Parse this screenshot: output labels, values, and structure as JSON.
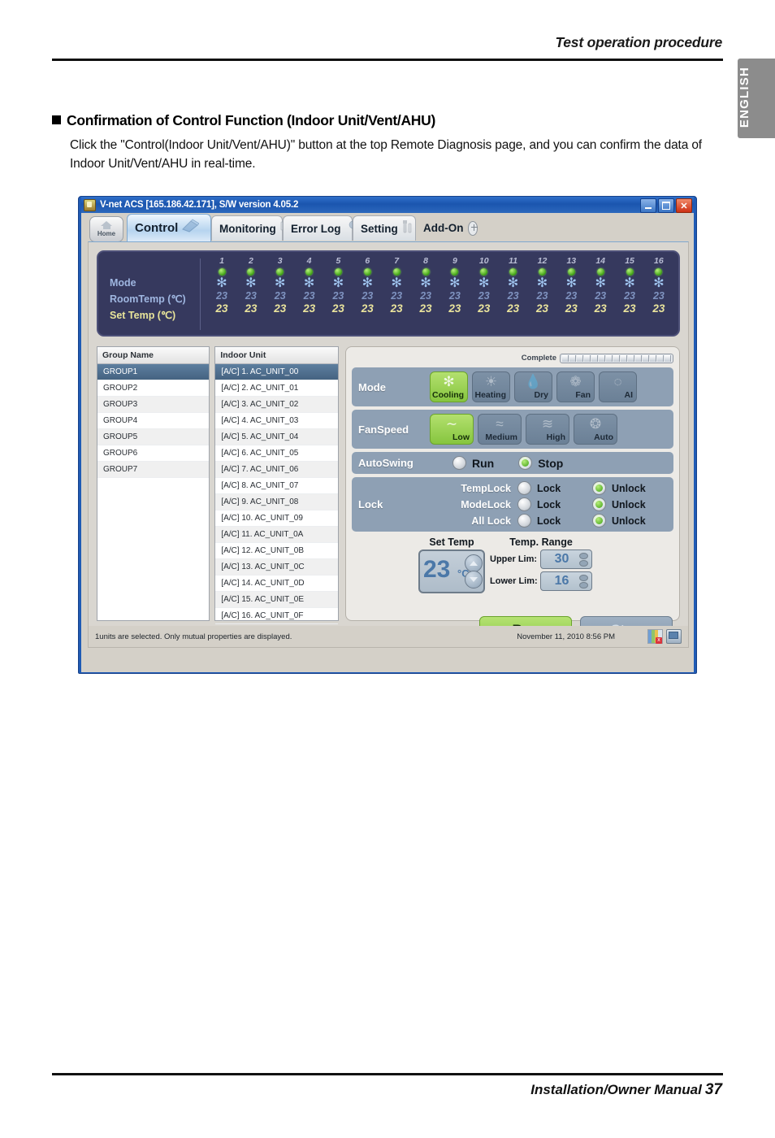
{
  "page": {
    "header_title": "Test operation procedure",
    "side_tab": "ENGLISH",
    "section_heading": "Confirmation of Control Function (Indoor Unit/Vent/AHU)",
    "section_body": "Click the \"Control(Indoor Unit/Vent/AHU)\" button at the top Remote Diagnosis page, and  you can confirm the data of Indoor Unit/Vent/AHU in real-time.",
    "footer_text": "Installation/Owner Manual",
    "page_number": "37"
  },
  "window": {
    "title": "V-net ACS [165.186.42.171],   S/W version 4.05.2",
    "app_icon": "app-icon",
    "minimize": "_",
    "maximize": "□",
    "close": "✕"
  },
  "toolbar": {
    "home_label": "Home",
    "tabs": [
      {
        "label": "Control",
        "icon": "control-icon",
        "active": true
      },
      {
        "label": "Monitoring",
        "icon": "monitor-icon",
        "active": false
      },
      {
        "label": "Error Log",
        "icon": "wrench-icon",
        "active": false
      },
      {
        "label": "Setting",
        "icon": "tools-icon",
        "active": false
      },
      {
        "label": "Add-On",
        "icon": "plus-circle-icon",
        "active": false
      }
    ]
  },
  "status_panel": {
    "row_labels": {
      "mode": "Mode",
      "room_temp": "RoomTemp (℃)",
      "set_temp": "Set Temp  (℃)"
    },
    "columns": [
      {
        "index": "1",
        "power": "on",
        "mode_icon": "snowflake-icon",
        "room_temp": "23",
        "set_temp": "23"
      },
      {
        "index": "2",
        "power": "on",
        "mode_icon": "snowflake-icon",
        "room_temp": "23",
        "set_temp": "23"
      },
      {
        "index": "3",
        "power": "on",
        "mode_icon": "snowflake-icon",
        "room_temp": "23",
        "set_temp": "23"
      },
      {
        "index": "4",
        "power": "on",
        "mode_icon": "snowflake-icon",
        "room_temp": "23",
        "set_temp": "23"
      },
      {
        "index": "5",
        "power": "on",
        "mode_icon": "snowflake-icon",
        "room_temp": "23",
        "set_temp": "23"
      },
      {
        "index": "6",
        "power": "on",
        "mode_icon": "snowflake-icon",
        "room_temp": "23",
        "set_temp": "23"
      },
      {
        "index": "7",
        "power": "on",
        "mode_icon": "snowflake-icon",
        "room_temp": "23",
        "set_temp": "23"
      },
      {
        "index": "8",
        "power": "on",
        "mode_icon": "snowflake-icon",
        "room_temp": "23",
        "set_temp": "23"
      },
      {
        "index": "9",
        "power": "on",
        "mode_icon": "snowflake-icon",
        "room_temp": "23",
        "set_temp": "23"
      },
      {
        "index": "10",
        "power": "on",
        "mode_icon": "snowflake-icon",
        "room_temp": "23",
        "set_temp": "23"
      },
      {
        "index": "11",
        "power": "on",
        "mode_icon": "snowflake-icon",
        "room_temp": "23",
        "set_temp": "23"
      },
      {
        "index": "12",
        "power": "on",
        "mode_icon": "snowflake-icon",
        "room_temp": "23",
        "set_temp": "23"
      },
      {
        "index": "13",
        "power": "on",
        "mode_icon": "snowflake-icon",
        "room_temp": "23",
        "set_temp": "23"
      },
      {
        "index": "14",
        "power": "on",
        "mode_icon": "snowflake-icon",
        "room_temp": "23",
        "set_temp": "23"
      },
      {
        "index": "15",
        "power": "on",
        "mode_icon": "snowflake-icon",
        "room_temp": "23",
        "set_temp": "23"
      },
      {
        "index": "16",
        "power": "on",
        "mode_icon": "snowflake-icon",
        "room_temp": "23",
        "set_temp": "23"
      }
    ]
  },
  "group_list": {
    "header": "Group Name",
    "rows": [
      {
        "label": "GROUP1",
        "selected": true
      },
      {
        "label": "GROUP2",
        "selected": false
      },
      {
        "label": "GROUP3",
        "selected": false
      },
      {
        "label": "GROUP4",
        "selected": false
      },
      {
        "label": "GROUP5",
        "selected": false
      },
      {
        "label": "GROUP6",
        "selected": false
      },
      {
        "label": "GROUP7",
        "selected": false
      }
    ]
  },
  "unit_list": {
    "header": "Indoor Unit",
    "rows": [
      {
        "label": "[A/C]  1. AC_UNIT_00",
        "selected": true
      },
      {
        "label": "[A/C]  2. AC_UNIT_01",
        "selected": false
      },
      {
        "label": "[A/C]  3. AC_UNIT_02",
        "selected": false
      },
      {
        "label": "[A/C]  4. AC_UNIT_03",
        "selected": false
      },
      {
        "label": "[A/C]  5. AC_UNIT_04",
        "selected": false
      },
      {
        "label": "[A/C]  6. AC_UNIT_05",
        "selected": false
      },
      {
        "label": "[A/C]  7. AC_UNIT_06",
        "selected": false
      },
      {
        "label": "[A/C]  8. AC_UNIT_07",
        "selected": false
      },
      {
        "label": "[A/C]  9. AC_UNIT_08",
        "selected": false
      },
      {
        "label": "[A/C] 10. AC_UNIT_09",
        "selected": false
      },
      {
        "label": "[A/C] 11. AC_UNIT_0A",
        "selected": false
      },
      {
        "label": "[A/C] 12. AC_UNIT_0B",
        "selected": false
      },
      {
        "label": "[A/C] 13. AC_UNIT_0C",
        "selected": false
      },
      {
        "label": "[A/C] 14. AC_UNIT_0D",
        "selected": false
      },
      {
        "label": "[A/C] 15. AC_UNIT_0E",
        "selected": false
      },
      {
        "label": "[A/C] 16. AC_UNIT_0F",
        "selected": false
      }
    ]
  },
  "control_panel": {
    "complete_label": "Complete",
    "progress_segments": 15,
    "mode": {
      "label": "Mode",
      "options": [
        {
          "label": "Cooling",
          "icon": "snowflake-icon",
          "selected": true
        },
        {
          "label": "Heating",
          "icon": "sun-icon",
          "selected": false
        },
        {
          "label": "Dry",
          "icon": "droplet-icon",
          "selected": false
        },
        {
          "label": "Fan",
          "icon": "fan-icon",
          "selected": false
        },
        {
          "label": "AI",
          "icon": "ai-icon",
          "selected": false
        }
      ]
    },
    "fanspeed": {
      "label": "FanSpeed",
      "options": [
        {
          "label": "Low",
          "icon": "wave-one-icon",
          "selected": true
        },
        {
          "label": "Medium",
          "icon": "wave-two-icon",
          "selected": false
        },
        {
          "label": "High",
          "icon": "wave-three-icon",
          "selected": false
        },
        {
          "label": "Auto",
          "icon": "fan-auto-icon",
          "selected": false
        }
      ]
    },
    "autoswing": {
      "label": "AutoSwing",
      "options": [
        {
          "label": "Run",
          "selected": false
        },
        {
          "label": "Stop",
          "selected": true
        }
      ]
    },
    "lock": {
      "label": "Lock",
      "rows": [
        {
          "name": "TempLock",
          "lock_label": "Lock",
          "unlock_label": "Unlock",
          "value": "Unlock"
        },
        {
          "name": "ModeLock",
          "lock_label": "Lock",
          "unlock_label": "Unlock",
          "value": "Unlock"
        },
        {
          "name": "All Lock",
          "lock_label": "Lock",
          "unlock_label": "Unlock",
          "value": "Unlock"
        }
      ]
    },
    "set_temp": {
      "title": "Set Temp",
      "value": "23",
      "unit": "°C"
    },
    "temp_range": {
      "title": "Temp. Range",
      "upper_label": "Upper Lim:",
      "upper_value": "30",
      "lower_label": "Lower Lim:",
      "lower_value": "16"
    },
    "actions": {
      "run": "Run",
      "stop": "Stop"
    }
  },
  "statusbar": {
    "message": "1units are selected. Only mutual properties are displayed.",
    "datetime": "November 11, 2010  8:56 PM",
    "tray_icons": [
      "chart-status-icon",
      "monitor-status-icon"
    ]
  },
  "colors": {
    "accent_green": "#8bc843",
    "panel_dark": "#36395e",
    "band_blue": "#8ea0b4",
    "titlebar_blue": "#1f5bb5",
    "selected_row": "#4f6f8f",
    "set_temp_blue": "#4b78a8"
  }
}
